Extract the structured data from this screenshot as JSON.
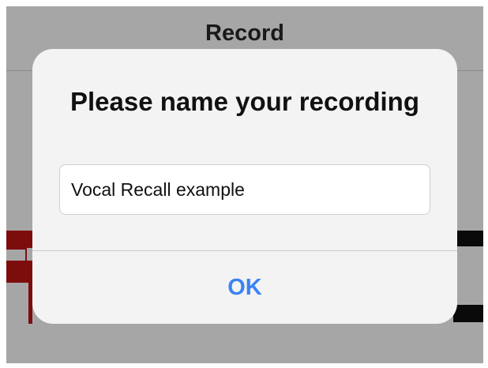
{
  "nav": {
    "title": "Record"
  },
  "dialog": {
    "title": "Please name your recording",
    "name_field": {
      "value": "Vocal Recall example",
      "placeholder": ""
    },
    "ok_label": "OK"
  },
  "colors": {
    "accent": "#3a82f6",
    "overlay": "#a6a6a6",
    "dialog_background": "#f3f3f3",
    "background_red": "#7d0d0d",
    "background_black": "#0a0a0a"
  }
}
